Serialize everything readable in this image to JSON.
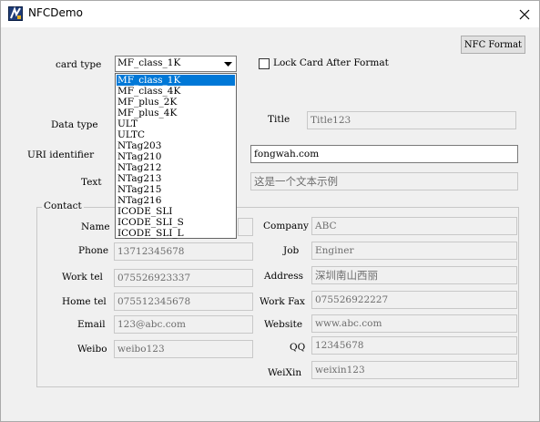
{
  "window": {
    "title": "NFCDemo",
    "icon": "app-icon",
    "close_icon": "close-icon"
  },
  "toolbar": {
    "nfc_format_label": "NFC Format"
  },
  "card": {
    "label": "card type",
    "selected": "MF_class_1K",
    "options": [
      "MF_class_1K",
      "MF_class_4K",
      "MF_plus_2K",
      "MF_plus_4K",
      "ULT",
      "ULTC",
      "NTag203",
      "NTag210",
      "NTag212",
      "NTag213",
      "NTag215",
      "NTag216",
      "ICODE_SLI",
      "ICODE_SLI_S",
      "ICODE_SLI_L"
    ]
  },
  "lock": {
    "label": "Lock Card After Format",
    "checked": false
  },
  "data_type": {
    "label": "Data type"
  },
  "title_field": {
    "label": "Title",
    "value": "Title123"
  },
  "uri": {
    "label": "URI identifier",
    "value": "fongwah.com"
  },
  "text_field": {
    "label": "Text",
    "value": "这是一个文本示例"
  },
  "contact": {
    "label": "Contact",
    "name": {
      "label": "Name"
    },
    "company": {
      "label": "Company",
      "value": "ABC"
    },
    "phone": {
      "label": "Phone",
      "value": "13712345678"
    },
    "job": {
      "label": "Job",
      "value": "Enginer"
    },
    "work_tel": {
      "label": "Work tel",
      "value": "075526923337"
    },
    "address": {
      "label": "Address",
      "value": "深圳南山西丽"
    },
    "home_tel": {
      "label": "Home tel",
      "value": "075512345678"
    },
    "work_fax": {
      "label": "Work Fax",
      "value": "075526922227"
    },
    "email": {
      "label": "Email",
      "value": "123@abc.com"
    },
    "website": {
      "label": "Website",
      "value": "www.abc.com"
    },
    "weibo": {
      "label": "Weibo",
      "value": "weibo123"
    },
    "qq": {
      "label": "QQ",
      "value": "12345678"
    },
    "weixin": {
      "label": "WeiXin",
      "value": "weixin123"
    }
  },
  "colors": {
    "selection": "#0078d7",
    "window_bg": "#f0f0f0",
    "disabled_text": "#6d6d6d"
  }
}
